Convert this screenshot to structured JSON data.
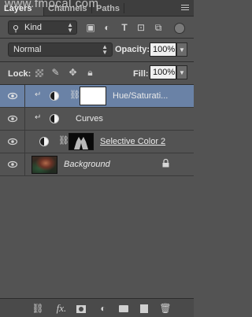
{
  "watermark": "www.fmocal.com",
  "tabs": [
    {
      "label": "Layers",
      "active": true
    },
    {
      "label": "Channels",
      "active": false
    },
    {
      "label": "Paths",
      "active": false
    }
  ],
  "filter": {
    "kind_label": "Kind",
    "icons": [
      "image-filter-icon",
      "adjustment-filter-icon",
      "type-filter-icon",
      "shape-filter-icon",
      "smart-object-filter-icon",
      "filter-toggle-icon"
    ]
  },
  "blend": {
    "mode": "Normal",
    "opacity_label": "Opacity:",
    "opacity_value": "100%"
  },
  "lock": {
    "label": "Lock:",
    "fill_label": "Fill:",
    "fill_value": "100%"
  },
  "layers": [
    {
      "name": "Hue/Saturati...",
      "type": "adjustment",
      "clipped": true,
      "selected": true,
      "mask": "white",
      "style": "normal"
    },
    {
      "name": "Curves",
      "type": "adjustment",
      "clipped": true,
      "selected": false,
      "mask": "none",
      "style": "normal"
    },
    {
      "name": "Selective Color 2",
      "type": "adjustment",
      "clipped": false,
      "selected": false,
      "mask": "dark",
      "style": "underline"
    },
    {
      "name": "Background",
      "type": "image",
      "clipped": false,
      "selected": false,
      "mask": "none",
      "style": "italic",
      "locked": true
    }
  ],
  "bottom_icons": [
    "link-layers-icon",
    "fx-icon",
    "add-mask-icon",
    "new-adjustment-icon",
    "new-group-icon",
    "new-layer-icon",
    "trash-icon"
  ],
  "colors": {
    "panel": "#535353",
    "selected": "#6a82a6",
    "tab_bar": "#3e3e3e"
  }
}
